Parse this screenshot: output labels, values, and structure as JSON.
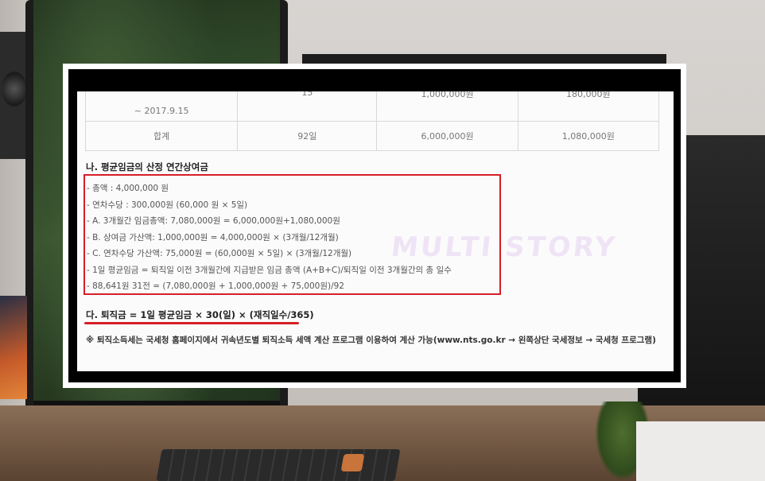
{
  "watermark": "MULTI STORY",
  "table": {
    "rows": [
      {
        "period": "~ 2017.9.15",
        "days": "15",
        "wage": "1,000,000원",
        "bonus": "180,000원"
      },
      {
        "period": "합계",
        "days": "92일",
        "wage": "6,000,000원",
        "bonus": "1,080,000원"
      }
    ]
  },
  "section_title": "나. 평균임금의 산정 연간상여금",
  "items": [
    "- 총액 : 4,000,000 원",
    "- 연차수당 : 300,000원 (60,000 원 × 5일)",
    "- A. 3개월간 임금총액: 7,080,000원 = 6,000,000원+1,080,000원",
    "- B. 상여금 가산액: 1,000,000원 = 4,000,000원 × (3개월/12개월)",
    "- C. 연차수당 가산액: 75,000원 = (60,000원 × 5일) × (3개월/12개월)",
    "- 1일 평균임금 = 퇴직일 이전 3개월간에 지급받은 임금 총액 (A+B+C)/퇴직일 이전 3개월간의 총 일수",
    "- 88,641원 31전 = (7,080,000원 + 1,000,000원 + 75,000원)/92"
  ],
  "formula": "다. 퇴직금 = 1일 평균임금 × 30(일) × (재직일수/365)",
  "note": "※ 퇴직소득세는 국세청 홈페이지에서 귀속년도별 퇴직소득 세액 계산 프로그램 이용하여 계산 가능(www.nts.go.kr → 왼쪽상단 국세정보 → 국세청 프로그램)",
  "colors": {
    "highlight": "#d61f28"
  }
}
